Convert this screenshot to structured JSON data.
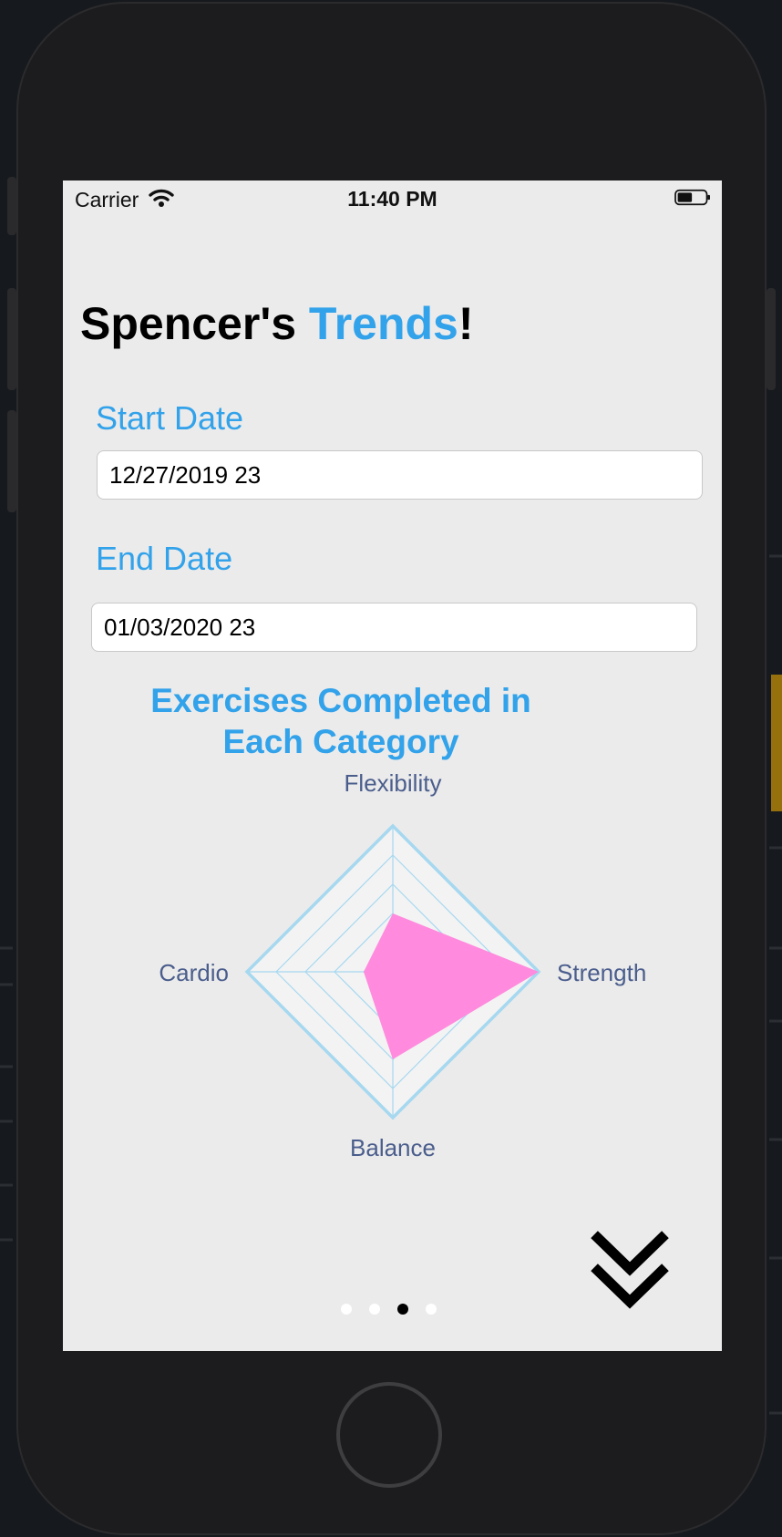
{
  "status_bar": {
    "carrier": "Carrier",
    "time": "11:40 PM",
    "wifi_icon": "wifi-icon",
    "battery_icon": "battery-icon"
  },
  "header": {
    "title_prefix": "Spencer's ",
    "title_accent": "Trends",
    "title_suffix": "!"
  },
  "start_date": {
    "label": "Start Date",
    "value": "12/27/2019 23"
  },
  "end_date": {
    "label": "End Date",
    "value": "01/03/2020 23"
  },
  "chart_title_line1": "Exercises Completed in",
  "chart_title_line2": "Each Category",
  "chart_data": {
    "type": "radar",
    "title": "Exercises Completed in Each Category",
    "categories": [
      "Flexibility",
      "Strength",
      "Balance",
      "Cardio"
    ],
    "series": [
      {
        "values": [
          0.4,
          1.0,
          0.6,
          0.2
        ]
      }
    ],
    "range": [
      0,
      1
    ],
    "rings": 5,
    "colors": {
      "fill": "#ff8ade",
      "grid": "#a6d8f0",
      "web_bg": "#f3f3f3",
      "label": "#4a5d8c"
    }
  },
  "page_indicator": {
    "count": 4,
    "active_index": 2
  },
  "colors": {
    "accent": "#32a2ea",
    "screen_bg": "#ebebeb"
  },
  "icons": {
    "scroll_down": "double-chevron-down-icon"
  }
}
